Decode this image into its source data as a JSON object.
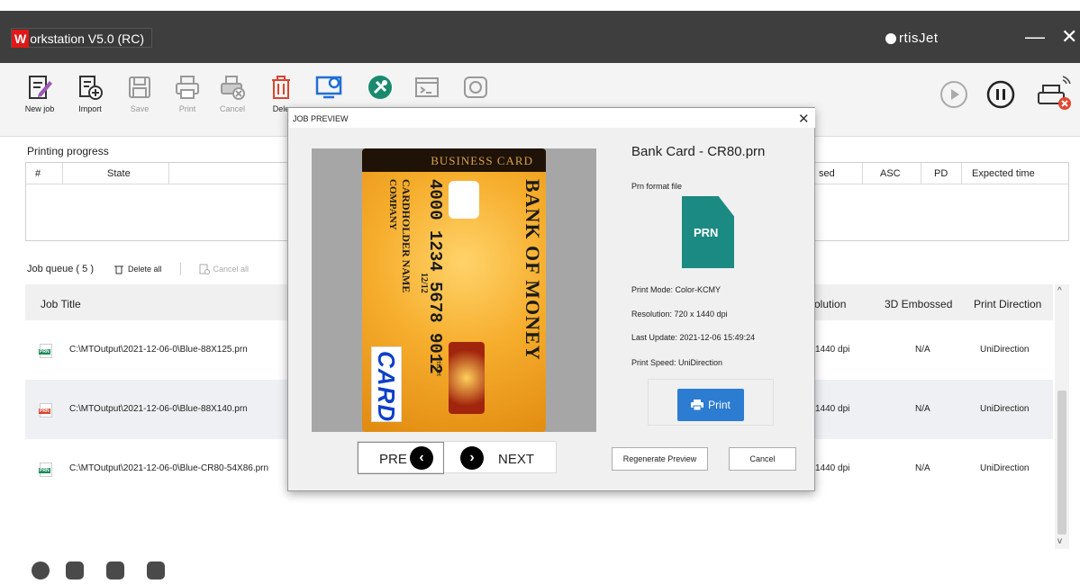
{
  "app": {
    "title_letter": "W",
    "title_rest": "orkstation V5.0 (RC)",
    "brand": "rtisJet",
    "minimize_glyph": "—",
    "close_glyph": "✕"
  },
  "toolbar": {
    "new_job": "New job",
    "import": "Import",
    "save": "Save",
    "print": "Print",
    "cancel": "Cancel",
    "delete": "Dele"
  },
  "progress": {
    "label": "Printing progress",
    "columns": {
      "num": "#",
      "state": "State",
      "used": "sed",
      "asc": "ASC",
      "pd": "PD",
      "expected": "Expected time"
    }
  },
  "queue": {
    "label": "Job queue ( 5 )",
    "delete_all": "Delete all",
    "cancel_all": "Cancel all",
    "columns": {
      "job_title": "Job Title",
      "resolution": "olution",
      "embossed": "3D Embossed",
      "direction": "Print Direction"
    },
    "rows": [
      {
        "badge": "PRN",
        "title": "C:\\MTOutput\\2021-12-06-0\\Blue-88X125.prn",
        "resolution": "1440 dpi",
        "embossed": "N/A",
        "direction": "UniDirection"
      },
      {
        "badge": "PRN",
        "title": "C:\\MTOutput\\2021-12-06-0\\Blue-88X140.prn",
        "resolution": "1440 dpi",
        "embossed": "N/A",
        "direction": "UniDirection"
      },
      {
        "badge": "PRN",
        "title": "C:\\MTOutput\\2021-12-06-0\\Blue-CR80-54X86.prn",
        "resolution": "1440 dpi",
        "embossed": "N/A",
        "direction": "UniDirection"
      }
    ]
  },
  "modal": {
    "title": "JOB PREVIEW",
    "close": "✕",
    "file_name": "Bank Card - CR80.prn",
    "format_label": "Prn format file",
    "format_badge": "PRN",
    "print_mode": "Print Mode:  Color-KCMY",
    "resolution": "Resolution:   720 x 1440 dpi",
    "last_update": "Last Update:  2021-12-06 15:49:24",
    "print_speed": "Print Speed:  UniDirection",
    "print_button": "Print",
    "prev": "PRE",
    "next": "NEXT",
    "regenerate": "Regenerate Preview",
    "cancel": "Cancel",
    "card": {
      "header": "BUSINESS CARD",
      "bank": "BANK OF MONEY",
      "number": "4000 1234 5678 9012",
      "holder": "CARDHOLDER NAME",
      "company": "COMPANY",
      "expiry": "12/12",
      "brand": "rtisJet",
      "card_word": "CARD"
    }
  },
  "colors": {
    "titlebar": "#3e3e3e",
    "accent_red": "#e01818",
    "prn_teal": "#1b8a82",
    "print_blue": "#2c7cd1"
  }
}
